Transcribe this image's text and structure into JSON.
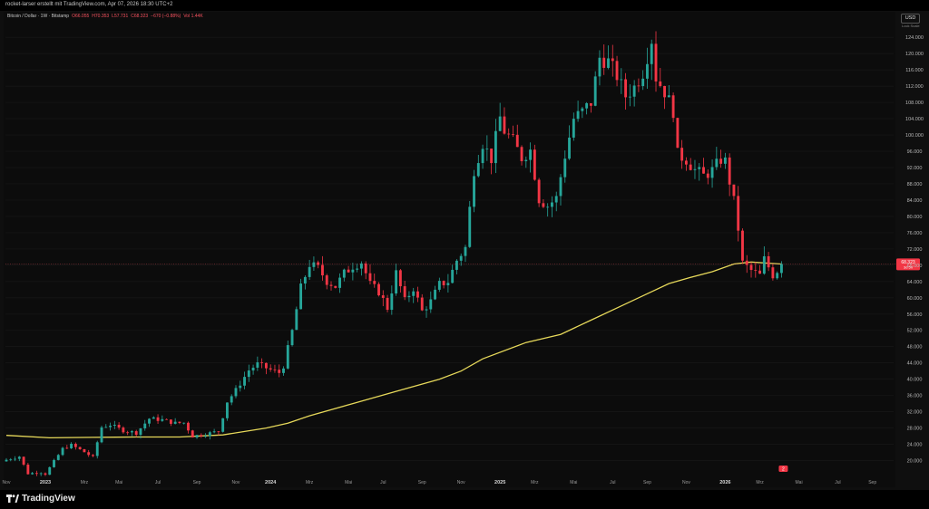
{
  "header": {
    "author_line": "rocket-larser erstellt mit TradingView.com, Apr 07, 2026 18:30 UTC+2"
  },
  "legend": {
    "symbol": "Bitcoin / Dollar · 1W · Bitstamp",
    "open": "O66.055",
    "high": "H70.353",
    "low": "L57.731",
    "close": "C68.323",
    "change": "−670 (−0.88%)",
    "volume": "Vol 1.44K"
  },
  "currency_button": "USD",
  "lock_label": "Lock Scale",
  "price_badge": {
    "price": "68.323",
    "countdown": "3d 5h"
  },
  "event_badge": "2",
  "branding": {
    "name": "TradingView"
  },
  "colors": {
    "background": "#0c0c0c",
    "up": "#26a69a",
    "down": "#f23645",
    "ma_line": "#e6d85a",
    "price_line": "#f7525f",
    "axis_text": "#b8b8b8"
  },
  "chart_data": {
    "type": "candlestick",
    "interval": "1W",
    "ylim": [
      17000,
      126500
    ],
    "y_ticks": [
      20000,
      24000,
      28000,
      32000,
      36000,
      40000,
      44000,
      48000,
      52000,
      56000,
      60000,
      64000,
      68000,
      72000,
      76000,
      80000,
      84000,
      88000,
      92000,
      96000,
      100000,
      104000,
      108000,
      112000,
      116000,
      120000,
      124000
    ],
    "y_tick_labels": [
      "20.000",
      "24.000",
      "28.000",
      "32.000",
      "36.000",
      "40.000",
      "44.000",
      "48.000",
      "52.000",
      "56.000",
      "60.000",
      "64.000",
      "68.000",
      "72.000",
      "76.000",
      "80.000",
      "84.000",
      "88.000",
      "92.000",
      "96.000",
      "100.000",
      "104.000",
      "108.000",
      "112.000",
      "116.000",
      "120.000",
      "124.000"
    ],
    "x_ticks": [
      {
        "label": "Nov",
        "week": 0,
        "bold": false
      },
      {
        "label": "2023",
        "week": 9,
        "bold": true
      },
      {
        "label": "Mrz",
        "week": 18,
        "bold": false
      },
      {
        "label": "Mai",
        "week": 26,
        "bold": false
      },
      {
        "label": "Jul",
        "week": 35,
        "bold": false
      },
      {
        "label": "Sep",
        "week": 44,
        "bold": false
      },
      {
        "label": "Nov",
        "week": 53,
        "bold": false
      },
      {
        "label": "2024",
        "week": 61,
        "bold": true
      },
      {
        "label": "Mrz",
        "week": 70,
        "bold": false
      },
      {
        "label": "Mai",
        "week": 79,
        "bold": false
      },
      {
        "label": "Jul",
        "week": 87,
        "bold": false
      },
      {
        "label": "Sep",
        "week": 96,
        "bold": false
      },
      {
        "label": "Nov",
        "week": 105,
        "bold": false
      },
      {
        "label": "2025",
        "week": 114,
        "bold": true
      },
      {
        "label": "Mrz",
        "week": 122,
        "bold": false
      },
      {
        "label": "Mai",
        "week": 131,
        "bold": false
      },
      {
        "label": "Jul",
        "week": 140,
        "bold": false
      },
      {
        "label": "Sep",
        "week": 148,
        "bold": false
      },
      {
        "label": "Nov",
        "week": 157,
        "bold": false
      },
      {
        "label": "2026",
        "week": 166,
        "bold": true
      },
      {
        "label": "Mrz",
        "week": 174,
        "bold": false
      },
      {
        "label": "Mai",
        "week": 183,
        "bold": false
      },
      {
        "label": "Jul",
        "week": 192,
        "bold": false
      },
      {
        "label": "Sep",
        "week": 200,
        "bold": false
      }
    ],
    "current_price": 68323,
    "last_week": 179,
    "anchors": [
      [
        0,
        20200
      ],
      [
        3,
        21000
      ],
      [
        5,
        16800
      ],
      [
        8,
        17100
      ],
      [
        9,
        16700
      ],
      [
        13,
        22900
      ],
      [
        15,
        23800
      ],
      [
        18,
        22100
      ],
      [
        20,
        20800
      ],
      [
        22,
        28200
      ],
      [
        24,
        28800
      ],
      [
        27,
        27400
      ],
      [
        30,
        26800
      ],
      [
        33,
        30300
      ],
      [
        36,
        30000
      ],
      [
        39,
        29200
      ],
      [
        41,
        29300
      ],
      [
        43,
        26000
      ],
      [
        46,
        26500
      ],
      [
        49,
        27200
      ],
      [
        51,
        34500
      ],
      [
        53,
        37300
      ],
      [
        56,
        42200
      ],
      [
        58,
        43700
      ],
      [
        61,
        42300
      ],
      [
        63,
        41600
      ],
      [
        64,
        43300
      ],
      [
        66,
        51800
      ],
      [
        68,
        62500
      ],
      [
        70,
        68200
      ],
      [
        72,
        67300
      ],
      [
        74,
        64100
      ],
      [
        76,
        62800
      ],
      [
        78,
        66000
      ],
      [
        80,
        67800
      ],
      [
        82,
        68800
      ],
      [
        84,
        63300
      ],
      [
        86,
        61500
      ],
      [
        88,
        57500
      ],
      [
        90,
        66100
      ],
      [
        92,
        59200
      ],
      [
        94,
        62400
      ],
      [
        96,
        56700
      ],
      [
        98,
        59100
      ],
      [
        100,
        63300
      ],
      [
        102,
        64000
      ],
      [
        104,
        69200
      ],
      [
        106,
        72300
      ],
      [
        108,
        91500
      ],
      [
        110,
        98000
      ],
      [
        112,
        94200
      ],
      [
        114,
        104300
      ],
      [
        115,
        101000
      ],
      [
        117,
        98500
      ],
      [
        119,
        94400
      ],
      [
        121,
        96300
      ],
      [
        123,
        84300
      ],
      [
        125,
        82600
      ],
      [
        127,
        84500
      ],
      [
        129,
        95000
      ],
      [
        131,
        104000
      ],
      [
        133,
        105700
      ],
      [
        135,
        108000
      ],
      [
        137,
        119000
      ],
      [
        139,
        118000
      ],
      [
        141,
        114600
      ],
      [
        143,
        109600
      ],
      [
        145,
        111800
      ],
      [
        147,
        115500
      ],
      [
        149,
        123500
      ],
      [
        150,
        114200
      ],
      [
        152,
        110700
      ],
      [
        154,
        106000
      ],
      [
        155,
        95200
      ],
      [
        157,
        94000
      ],
      [
        159,
        91400
      ],
      [
        161,
        90000
      ],
      [
        163,
        91300
      ],
      [
        165,
        94000
      ],
      [
        166,
        93500
      ],
      [
        168,
        83700
      ],
      [
        169,
        77000
      ],
      [
        170,
        68500
      ],
      [
        172,
        66700
      ],
      [
        174,
        65500
      ],
      [
        175,
        69500
      ],
      [
        177,
        65600
      ],
      [
        178,
        66700
      ],
      [
        179,
        68323
      ]
    ],
    "ma_points": [
      [
        0,
        26200
      ],
      [
        10,
        25600
      ],
      [
        20,
        25700
      ],
      [
        30,
        25800
      ],
      [
        40,
        25800
      ],
      [
        50,
        26300
      ],
      [
        60,
        28000
      ],
      [
        65,
        29200
      ],
      [
        70,
        31000
      ],
      [
        80,
        34000
      ],
      [
        90,
        37000
      ],
      [
        100,
        40000
      ],
      [
        105,
        42000
      ],
      [
        110,
        45000
      ],
      [
        120,
        49000
      ],
      [
        128,
        51000
      ],
      [
        135,
        54500
      ],
      [
        142,
        58000
      ],
      [
        148,
        61000
      ],
      [
        153,
        63500
      ],
      [
        158,
        65000
      ],
      [
        163,
        66400
      ],
      [
        168,
        68300
      ],
      [
        172,
        68800
      ],
      [
        176,
        68500
      ],
      [
        179,
        68300
      ]
    ]
  }
}
